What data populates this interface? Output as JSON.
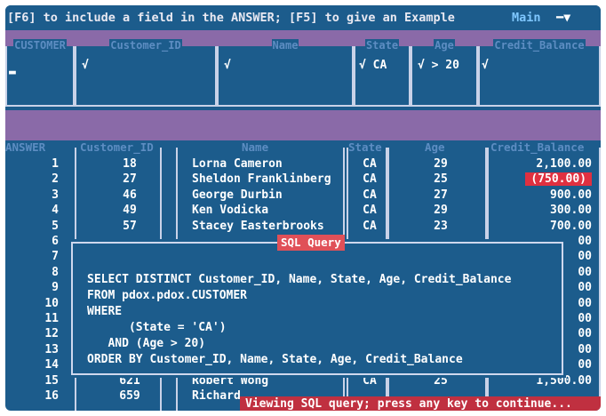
{
  "topbar": {
    "hint": "[F6] to include a field in the ANSWER; [F5] to give an Example",
    "mode": "Main",
    "arrow": "━▼"
  },
  "query_form": {
    "table_label": "CUSTOMER",
    "columns": [
      {
        "name": "Customer_ID",
        "value": "√"
      },
      {
        "name": "Name",
        "value": "√"
      },
      {
        "name": "State",
        "value": "√ CA"
      },
      {
        "name": "Age",
        "value": "√ > 20"
      },
      {
        "name": "Credit_Balance",
        "value": "√"
      }
    ],
    "cursor": "▬"
  },
  "answer": {
    "label": "ANSWER",
    "headers": {
      "id": "Customer_ID",
      "name": "Name",
      "state": "State",
      "age": "Age",
      "credit": "Credit_Balance"
    },
    "rows": [
      {
        "n": "1",
        "id": "18",
        "name": "Lorna Cameron",
        "state": "CA",
        "age": "29",
        "credit": "2,100.00"
      },
      {
        "n": "2",
        "id": "27",
        "name": "Sheldon Franklinberg",
        "state": "CA",
        "age": "25",
        "credit": "(750.00)"
      },
      {
        "n": "3",
        "id": "46",
        "name": "George Durbin",
        "state": "CA",
        "age": "27",
        "credit": "900.00"
      },
      {
        "n": "4",
        "id": "49",
        "name": "Ken Vodicka",
        "state": "CA",
        "age": "29",
        "credit": "300.00"
      },
      {
        "n": "5",
        "id": "57",
        "name": "Stacey Easterbrooks",
        "state": "CA",
        "age": "23",
        "credit": "700.00"
      },
      {
        "n": "6",
        "id": "",
        "name": "",
        "state": "",
        "age": "",
        "credit": "00"
      },
      {
        "n": "7",
        "id": "",
        "name": "",
        "state": "",
        "age": "",
        "credit": "00"
      },
      {
        "n": "8",
        "id": "",
        "name": "",
        "state": "",
        "age": "",
        "credit": "00"
      },
      {
        "n": "9",
        "id": "",
        "name": "",
        "state": "",
        "age": "",
        "credit": "00"
      },
      {
        "n": "10",
        "id": "",
        "name": "",
        "state": "",
        "age": "",
        "credit": "00"
      },
      {
        "n": "11",
        "id": "",
        "name": "",
        "state": "",
        "age": "",
        "credit": "00"
      },
      {
        "n": "12",
        "id": "",
        "name": "",
        "state": "",
        "age": "",
        "credit": "00"
      },
      {
        "n": "13",
        "id": "",
        "name": "",
        "state": "",
        "age": "",
        "credit": "00"
      },
      {
        "n": "14",
        "id": "",
        "name": "",
        "state": "",
        "age": "",
        "credit": "00"
      },
      {
        "n": "15",
        "id": "621",
        "name": "Robert Wong",
        "state": "CA",
        "age": "25",
        "credit": "1,500.00"
      },
      {
        "n": "16",
        "id": "659",
        "name": "Richard",
        "state": "",
        "age": "",
        "credit": ""
      }
    ]
  },
  "dialog": {
    "title": "SQL Query",
    "sql": "SELECT DISTINCT Customer_ID, Name, State, Age, Credit_Balance\nFROM pdox.pdox.CUSTOMER\nWHERE\n      (State = 'CA')\n   AND (Age > 20)\nORDER BY Customer_ID, Name, State, Age, Credit_Balance"
  },
  "status": "Viewing SQL query; press any key to continue...",
  "colors": {
    "screen_bg": "#1c5c8c",
    "band": "#8a6aa8",
    "header_text": "#5d8dc2",
    "status_bg": "#c03040",
    "negative_bg": "#e03040"
  }
}
